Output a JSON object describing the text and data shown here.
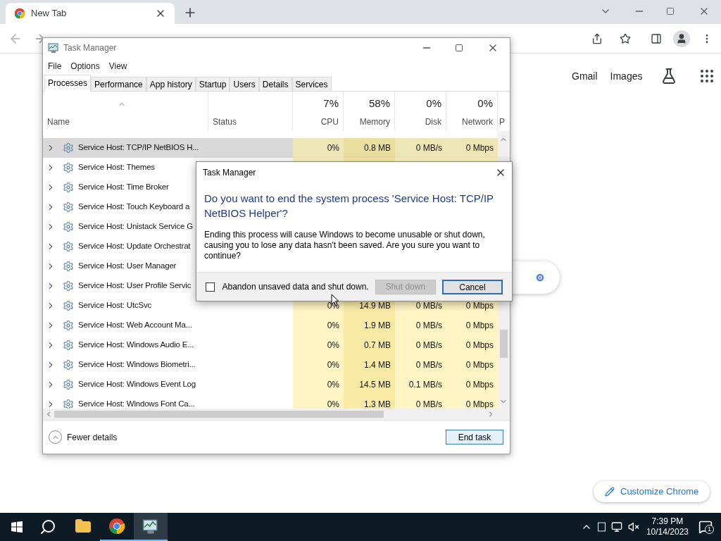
{
  "browser": {
    "tab": {
      "title": "New Tab"
    },
    "links": [
      {
        "label": "Gmail"
      },
      {
        "label": "Images"
      }
    ],
    "customize_button": "Customize Chrome"
  },
  "task_manager": {
    "title": "Task Manager",
    "menu": [
      "File",
      "Options",
      "View"
    ],
    "tabs": [
      {
        "label": "Processes",
        "selected": true
      },
      {
        "label": "Performance",
        "selected": false
      },
      {
        "label": "App history",
        "selected": false
      },
      {
        "label": "Startup",
        "selected": false
      },
      {
        "label": "Users",
        "selected": false
      },
      {
        "label": "Details",
        "selected": false
      },
      {
        "label": "Services",
        "selected": false
      }
    ],
    "columns": [
      {
        "label": "Name",
        "sorted": true
      },
      {
        "label": "Status"
      },
      {
        "label": "CPU",
        "total": "7%"
      },
      {
        "label": "Memory",
        "total": "58%"
      },
      {
        "label": "Disk",
        "total": "0%"
      },
      {
        "label": "Network",
        "total": "0%"
      },
      {
        "label": "P"
      }
    ],
    "rows": [
      {
        "name": "Service Host: TCP/IP NetBIOS H...",
        "selected": true,
        "cpu": "0%",
        "memory": "0.8 MB",
        "disk": "0 MB/s",
        "network": "0 Mbps"
      },
      {
        "name": "Service Host: Themes",
        "selected": false
      },
      {
        "name": "Service Host: Time Broker",
        "selected": false
      },
      {
        "name": "Service Host: Touch Keyboard a",
        "selected": false
      },
      {
        "name": "Service Host: Unistack Service G",
        "selected": false
      },
      {
        "name": "Service Host: Update Orchestrat",
        "selected": false
      },
      {
        "name": "Service Host: User Manager",
        "selected": false
      },
      {
        "name": "Service Host: User Profile Servic",
        "selected": false
      },
      {
        "name": "Service Host: UtcSvc",
        "selected": false,
        "cpu": "0%",
        "memory": "14.9 MB",
        "disk": "0 MB/s",
        "network": "0 Mbps"
      },
      {
        "name": "Service Host: Web Account Ma...",
        "selected": false,
        "cpu": "0%",
        "memory": "1.9 MB",
        "disk": "0 MB/s",
        "network": "0 Mbps"
      },
      {
        "name": "Service Host: Windows Audio E...",
        "selected": false,
        "cpu": "0%",
        "memory": "0.7 MB",
        "disk": "0 MB/s",
        "network": "0 Mbps"
      },
      {
        "name": "Service Host: Windows Biometri...",
        "selected": false,
        "cpu": "0%",
        "memory": "1.4 MB",
        "disk": "0 MB/s",
        "network": "0 Mbps"
      },
      {
        "name": "Service Host: Windows Event Log",
        "selected": false,
        "cpu": "0%",
        "memory": "14.5 MB",
        "disk": "0.1 MB/s",
        "network": "0 Mbps"
      },
      {
        "name": "Service Host: Windows Font Ca...",
        "selected": false,
        "cpu": "0%",
        "memory": "1.3 MB",
        "disk": "0 MB/s",
        "network": "0 Mbps"
      }
    ],
    "fewer_details": "Fewer details",
    "end_task": "End task"
  },
  "dialog": {
    "title": "Task Manager",
    "question": "Do you want to end the system process 'Service Host: TCP/IP NetBIOS Helper'?",
    "message": "Ending this process will cause Windows to become unusable or shut down, causing you to lose any data hasn't been saved. Are you sure you want to continue?",
    "checkbox": {
      "label": "Abandon unsaved data and shut down.",
      "checked": false
    },
    "buttons": [
      {
        "label": "Shut down",
        "disabled": true
      },
      {
        "label": "Cancel",
        "disabled": false
      }
    ]
  },
  "taskbar": {
    "apps": [
      {
        "kind": "explorer",
        "running": false,
        "selected": false
      },
      {
        "kind": "chrome",
        "running": true,
        "selected": false
      },
      {
        "kind": "taskmanager",
        "running": true,
        "selected": true
      }
    ],
    "clock": {
      "time": "7:39 PM",
      "date": "10/14/2023"
    },
    "notifications": "1"
  }
}
